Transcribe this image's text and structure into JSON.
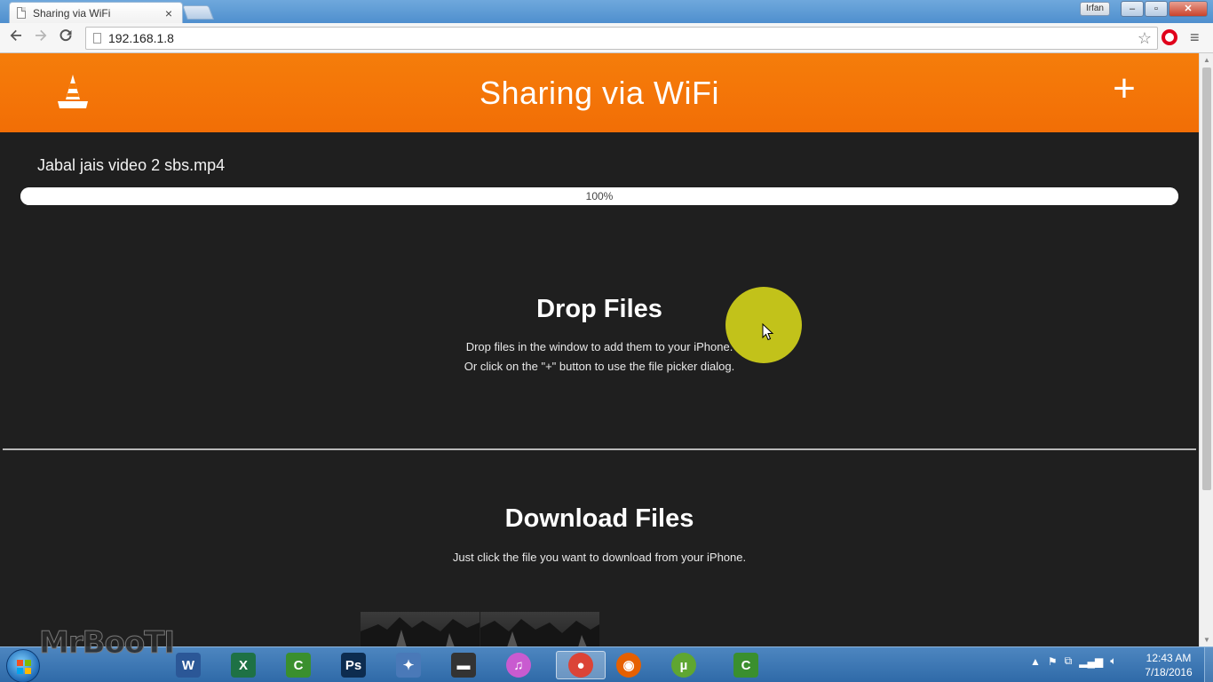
{
  "browser": {
    "tab_title": "Sharing via WiFi",
    "tab_close": "×",
    "user_badge": "Irfan",
    "window_controls": {
      "minimize": "–",
      "maximize": "▫",
      "close": "✕"
    },
    "url": "192.168.1.8",
    "icons": [
      "back-arrow-icon",
      "forward-arrow-icon",
      "reload-icon",
      "star-icon",
      "opera-icon",
      "menu-icon"
    ]
  },
  "header": {
    "title": "Sharing via WiFi",
    "add_label": "+",
    "brand_color": "#f57d0a"
  },
  "upload": {
    "file_name": "Jabal jais video 2 sbs.mp4",
    "progress_percent": 100,
    "progress_label": "100%"
  },
  "drop_section": {
    "title": "Drop Files",
    "line1": "Drop files in the window to add them to your iPhone.",
    "line2": "Or click on the \"+\" button to use the file picker dialog."
  },
  "download_section": {
    "title": "Download Files",
    "text": "Just click the file you want to download from your iPhone."
  },
  "taskbar": {
    "watermark": "MrBooTI",
    "apps": [
      {
        "name": "word",
        "label": "W",
        "color": "#2b5797"
      },
      {
        "name": "excel",
        "label": "X",
        "color": "#1e7145"
      },
      {
        "name": "camtasia",
        "label": "C",
        "color": "#3a8f2e"
      },
      {
        "name": "photoshop",
        "label": "Ps",
        "color": "#0d2c4f"
      },
      {
        "name": "tools",
        "label": "✦",
        "color": "#4a79b8"
      },
      {
        "name": "projector",
        "label": "▬",
        "color": "#333333"
      },
      {
        "name": "itunes",
        "label": "♫",
        "color": "#c95bd0"
      },
      {
        "name": "chrome",
        "label": "●",
        "color": "#db4437"
      },
      {
        "name": "firefox",
        "label": "◉",
        "color": "#e66000"
      },
      {
        "name": "utorrent",
        "label": "µ",
        "color": "#5fa631"
      },
      {
        "name": "camtasia-recorder",
        "label": "C",
        "color": "#3a8f2e"
      }
    ],
    "clock_time": "12:43 AM",
    "clock_date": "7/18/2016"
  }
}
